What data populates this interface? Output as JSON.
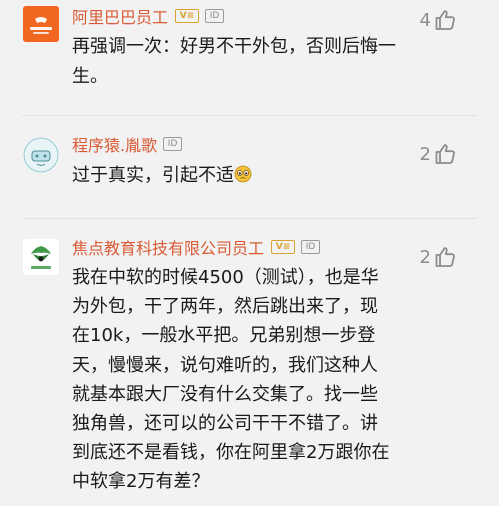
{
  "comments": [
    {
      "author": "阿里巴巴员工",
      "verified_badge": "V≡",
      "id_badge": "ID",
      "likes": "4",
      "text": "再强调一次：好男不干外包，否则后悔一生。",
      "avatar_logo_text": "Alibaba.com",
      "avatar_color": "#f2671f"
    },
    {
      "author": "程序猿.胤歌",
      "id_badge": "ID",
      "likes": "2",
      "text": "过于真实，引起不适",
      "emoji": "teary-eyed-emoji"
    },
    {
      "author": "焦点教育科技有限公司员工",
      "verified_badge": "V≡",
      "id_badge": "ID",
      "likes": "2",
      "text": "我在中软的时候4500（测试），也是华为外包，干了两年，然后跳出来了，现在10k，一般水平把。兄弟别想一步登天，慢慢来，说句难听的，我们这种人就基本跟大厂没有什么交集了。找一些独角兽，还可以的公司干干不错了。讲到底还不是看钱，你在阿里拿2万跟你在中软拿2万有差？",
      "avatar_logo_text": "焦点教育"
    }
  ],
  "colors": {
    "author_name": "#d95b35",
    "verified_badge": "#d9a233",
    "like": "#8c8c8c",
    "background": "#f2f2f2"
  }
}
